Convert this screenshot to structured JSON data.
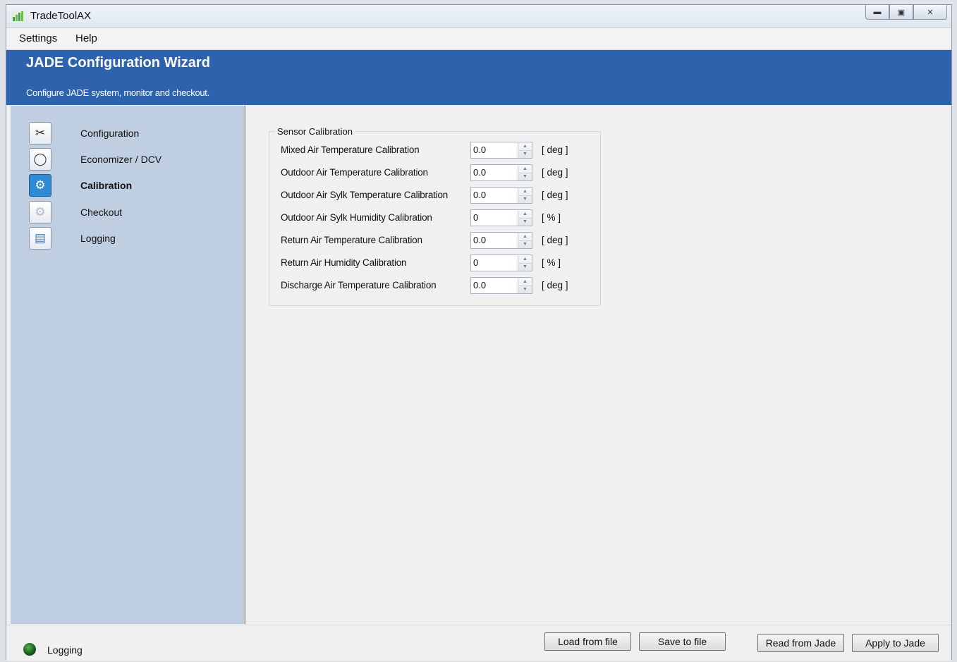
{
  "window": {
    "title": "TradeToolAX"
  },
  "menu": {
    "items": [
      "Settings",
      "Help"
    ]
  },
  "banner": {
    "title": "JADE Configuration Wizard",
    "subtitle": "Configure JADE system, monitor and checkout."
  },
  "sidebar": {
    "items": [
      {
        "label": "Configuration",
        "icon": "tools-icon",
        "active": false
      },
      {
        "label": "Economizer / DCV",
        "icon": "economizer-icon",
        "active": false
      },
      {
        "label": "Calibration",
        "icon": "calibration-icon",
        "active": true
      },
      {
        "label": "Checkout",
        "icon": "gear-icon",
        "active": false
      },
      {
        "label": "Logging",
        "icon": "chart-icon",
        "active": false
      }
    ]
  },
  "calibration": {
    "group_title": "Sensor Calibration",
    "rows": [
      {
        "label": "Mixed Air Temperature Calibration",
        "value": "0.0",
        "unit": "[ deg ]"
      },
      {
        "label": "Outdoor Air Temperature Calibration",
        "value": "0.0",
        "unit": "[ deg ]"
      },
      {
        "label": "Outdoor Air Sylk Temperature Calibration",
        "value": "0.0",
        "unit": "[ deg ]"
      },
      {
        "label": "Outdoor Air Sylk Humidity Calibration",
        "value": "0",
        "unit": "[ % ]"
      },
      {
        "label": "Return Air Temperature Calibration",
        "value": "0.0",
        "unit": "[ deg ]"
      },
      {
        "label": "Return Air  Humidity Calibration",
        "value": "0",
        "unit": "[ % ]"
      },
      {
        "label": "Discharge Air Temperature Calibration",
        "value": "0.0",
        "unit": "[ deg ]"
      }
    ]
  },
  "status": {
    "label": "Logging",
    "led_color": "#1f6b23"
  },
  "buttons": {
    "load": "Load from file",
    "save": "Save to  file",
    "read": "Read from Jade",
    "apply": "Apply to Jade"
  },
  "colors": {
    "banner": "#2e62ad",
    "sidebar": "#c0cee2"
  }
}
